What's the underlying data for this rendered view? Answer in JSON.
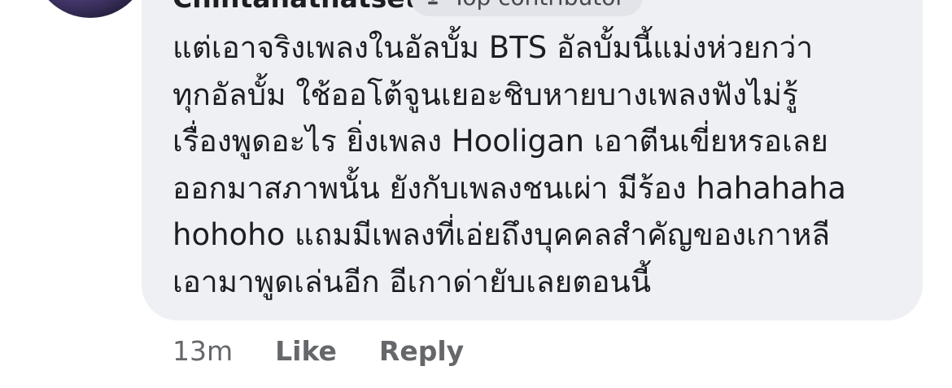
{
  "comment": {
    "author": "Chintanathatset",
    "badge": "Top contributor",
    "lines": [
      "แต่เอาจริงเพลงในอัลบั้ม BTS อัลบั้มนี้แม่งห่วยกว่า",
      "ทุกอัลบั้ม ใช้ออโต้จูนเยอะชิบหายบางเพลงฟังไม่รู้",
      "เรื่องพูดอะไร ยิ่งเพลง Hooligan เอาตีนเขี่ยหรอเลย",
      "ออกมาสภาพนั้น ยังกับเพลงชนเผ่า มีร้อง hahahaha",
      "hohoho แถมมีเพลงที่เอ่ยถึงบุคคลสำคัญของเกาหลี",
      "เอามาพูดเล่นอีก อีเกาด่ายับเลยตอนนี้"
    ]
  },
  "actions": {
    "time": "13m",
    "like": "Like",
    "reply": "Reply"
  },
  "icons": {
    "badge_icon": "trophy-icon"
  },
  "colors": {
    "bubble": "#eff0f4",
    "text": "#1c1e21",
    "secondary": "#65676b"
  }
}
